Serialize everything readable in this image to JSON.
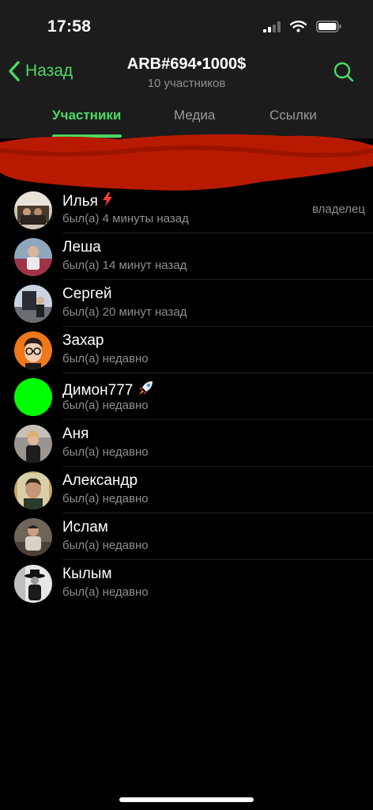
{
  "status_bar": {
    "time": "17:58"
  },
  "nav": {
    "back_label": "Назад",
    "title": "ARB#694•1000$",
    "subtitle": "10 участников"
  },
  "tabs": [
    {
      "label": "Участники",
      "active": true
    },
    {
      "label": "Медиа",
      "active": false
    },
    {
      "label": "Ссылки",
      "active": false
    }
  ],
  "colors": {
    "accent": "#4cd964",
    "redaction": "#b81a00",
    "online_dot": "#00ff00"
  },
  "members": [
    {
      "name": "Илья",
      "status": "был(а) 4 минуты назад",
      "role": "владелец",
      "badge": "lightning-emoji-icon"
    },
    {
      "name": "Леша",
      "status": "был(а) 14 минут назад"
    },
    {
      "name": "Сергей",
      "status": "был(а) 20 минут назад"
    },
    {
      "name": "Захар",
      "status": "был(а) недавно"
    },
    {
      "name": "Димон777",
      "status": "был(а) недавно",
      "badge": "rocket-emoji-icon"
    },
    {
      "name": "Аня",
      "status": "был(а) недавно"
    },
    {
      "name": "Александр",
      "status": "был(а) недавно"
    },
    {
      "name": "Ислам",
      "status": "был(а) недавно"
    },
    {
      "name": "Кылым",
      "status": "был(а) недавно"
    }
  ]
}
